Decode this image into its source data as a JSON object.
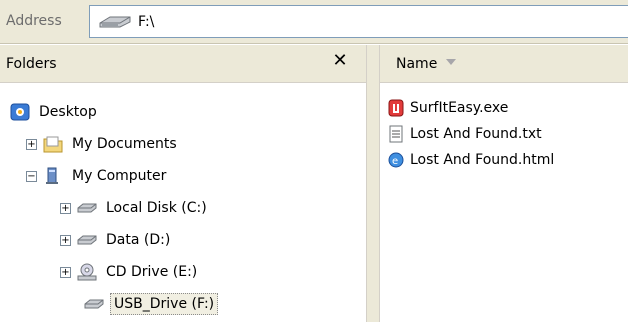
{
  "address": {
    "label": "Address",
    "value": "F:\\",
    "icon": "usb-drive-icon"
  },
  "folders": {
    "title": "Folders",
    "close_label": "✕",
    "items": [
      {
        "label": "Desktop",
        "icon": "desktop-icon",
        "expander": ""
      },
      {
        "label": "My Documents",
        "icon": "my-documents-icon",
        "expander": "+"
      },
      {
        "label": "My Computer",
        "icon": "my-computer-icon",
        "expander": "−"
      },
      {
        "label": "Local Disk (C:)",
        "icon": "hard-drive-icon",
        "expander": "+"
      },
      {
        "label": "Data (D:)",
        "icon": "hard-drive-icon",
        "expander": "+"
      },
      {
        "label": "CD Drive (E:)",
        "icon": "cd-drive-icon",
        "expander": "+"
      },
      {
        "label": "USB_Drive (F:)",
        "icon": "usb-drive-icon",
        "expander": "",
        "selected": true
      }
    ]
  },
  "files": {
    "column_name": "Name",
    "items": [
      {
        "label": "SurfItEasy.exe",
        "icon": "exe-icon"
      },
      {
        "label": "Lost And Found.txt",
        "icon": "text-file-icon"
      },
      {
        "label": "Lost And Found.html",
        "icon": "html-file-icon"
      }
    ]
  }
}
